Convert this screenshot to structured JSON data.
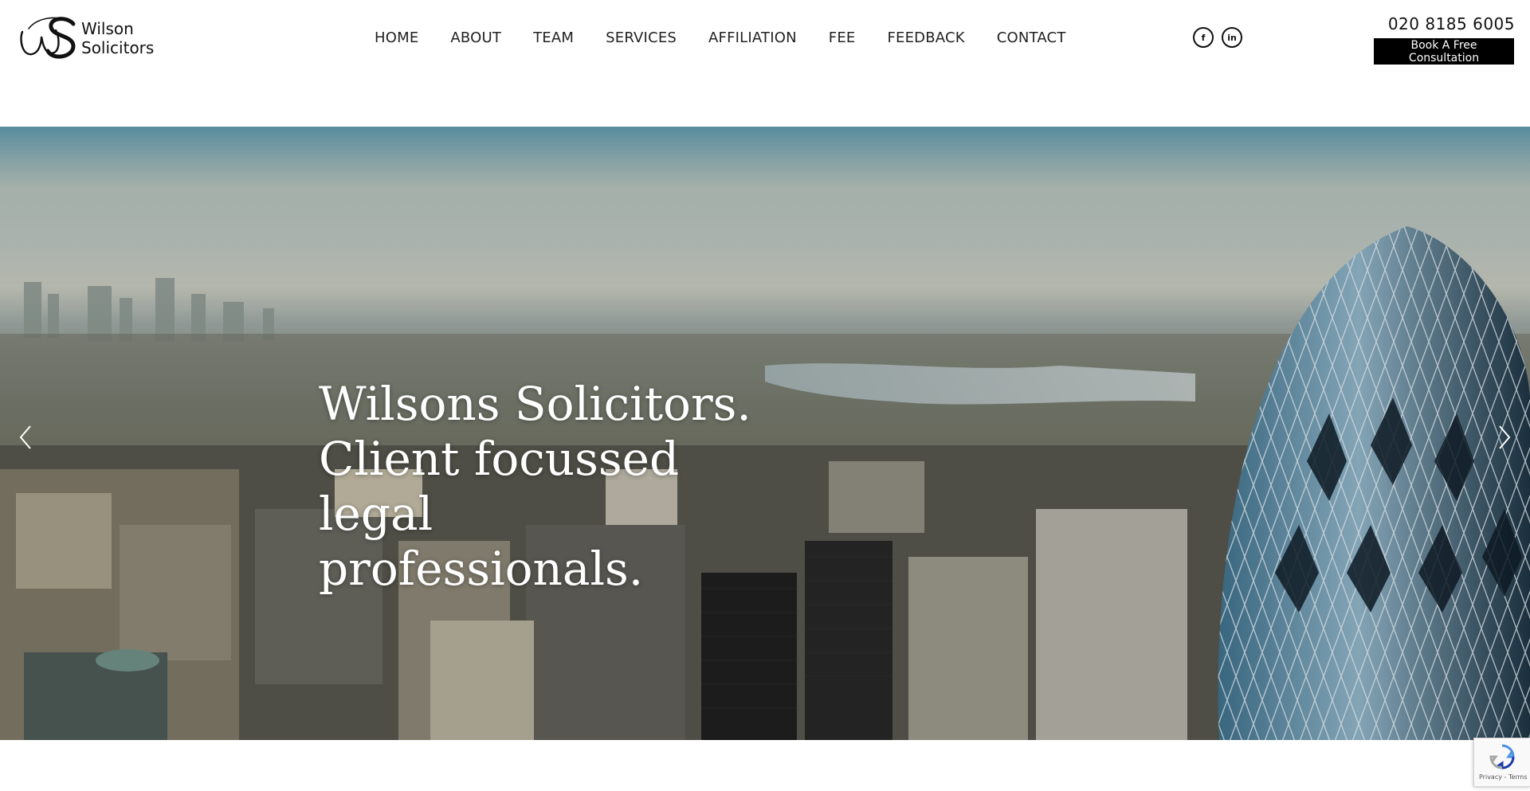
{
  "header": {
    "logo": {
      "line1": "Wilson",
      "line2": "Solicitors"
    },
    "nav": [
      "HOME",
      "ABOUT",
      "TEAM",
      "SERVICES",
      "AFFILIATION",
      "FEE",
      "FEEDBACK",
      "CONTACT"
    ],
    "social": [
      {
        "icon": "facebook-icon",
        "glyph": "f"
      },
      {
        "icon": "linkedin-icon",
        "glyph": "in"
      }
    ],
    "phone": "020 8185 6005",
    "cta_label": "Book A Free Consultation"
  },
  "hero": {
    "title_lines": [
      "Wilsons Solicitors.",
      "Client focussed legal",
      "professionals."
    ]
  },
  "recaptcha": {
    "terms": "Privacy - Terms"
  },
  "colors": {
    "cta_bg": "#000000",
    "hero_text": "#ffffff"
  }
}
